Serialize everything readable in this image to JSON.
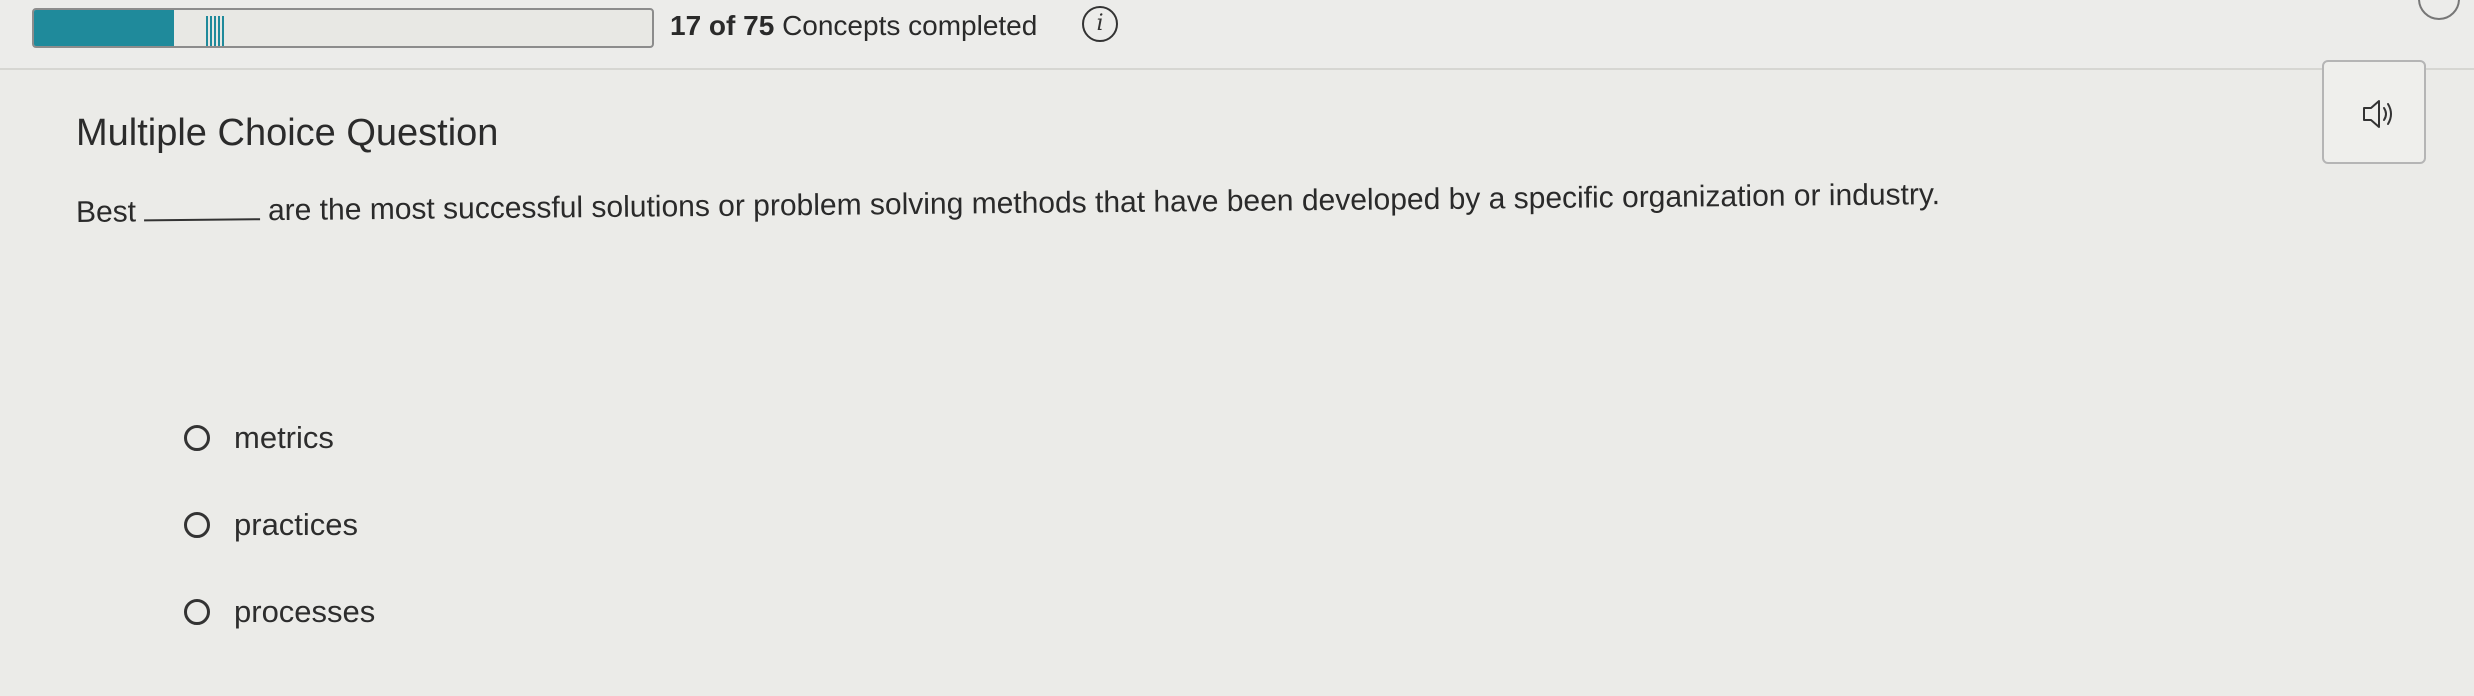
{
  "progress": {
    "count_completed": "17 of 75",
    "suffix": "Concepts completed",
    "fraction": 0.2267,
    "accent_color": "#1f8a9b"
  },
  "icons": {
    "info": "info-icon",
    "audio": "speaker-icon"
  },
  "question": {
    "type_label": "Multiple Choice Question",
    "prefix": "Best",
    "suffix": "are the most successful solutions or problem solving methods that have been developed by a specific organization or industry."
  },
  "options": [
    {
      "label": "metrics"
    },
    {
      "label": "practices"
    },
    {
      "label": "processes"
    }
  ]
}
